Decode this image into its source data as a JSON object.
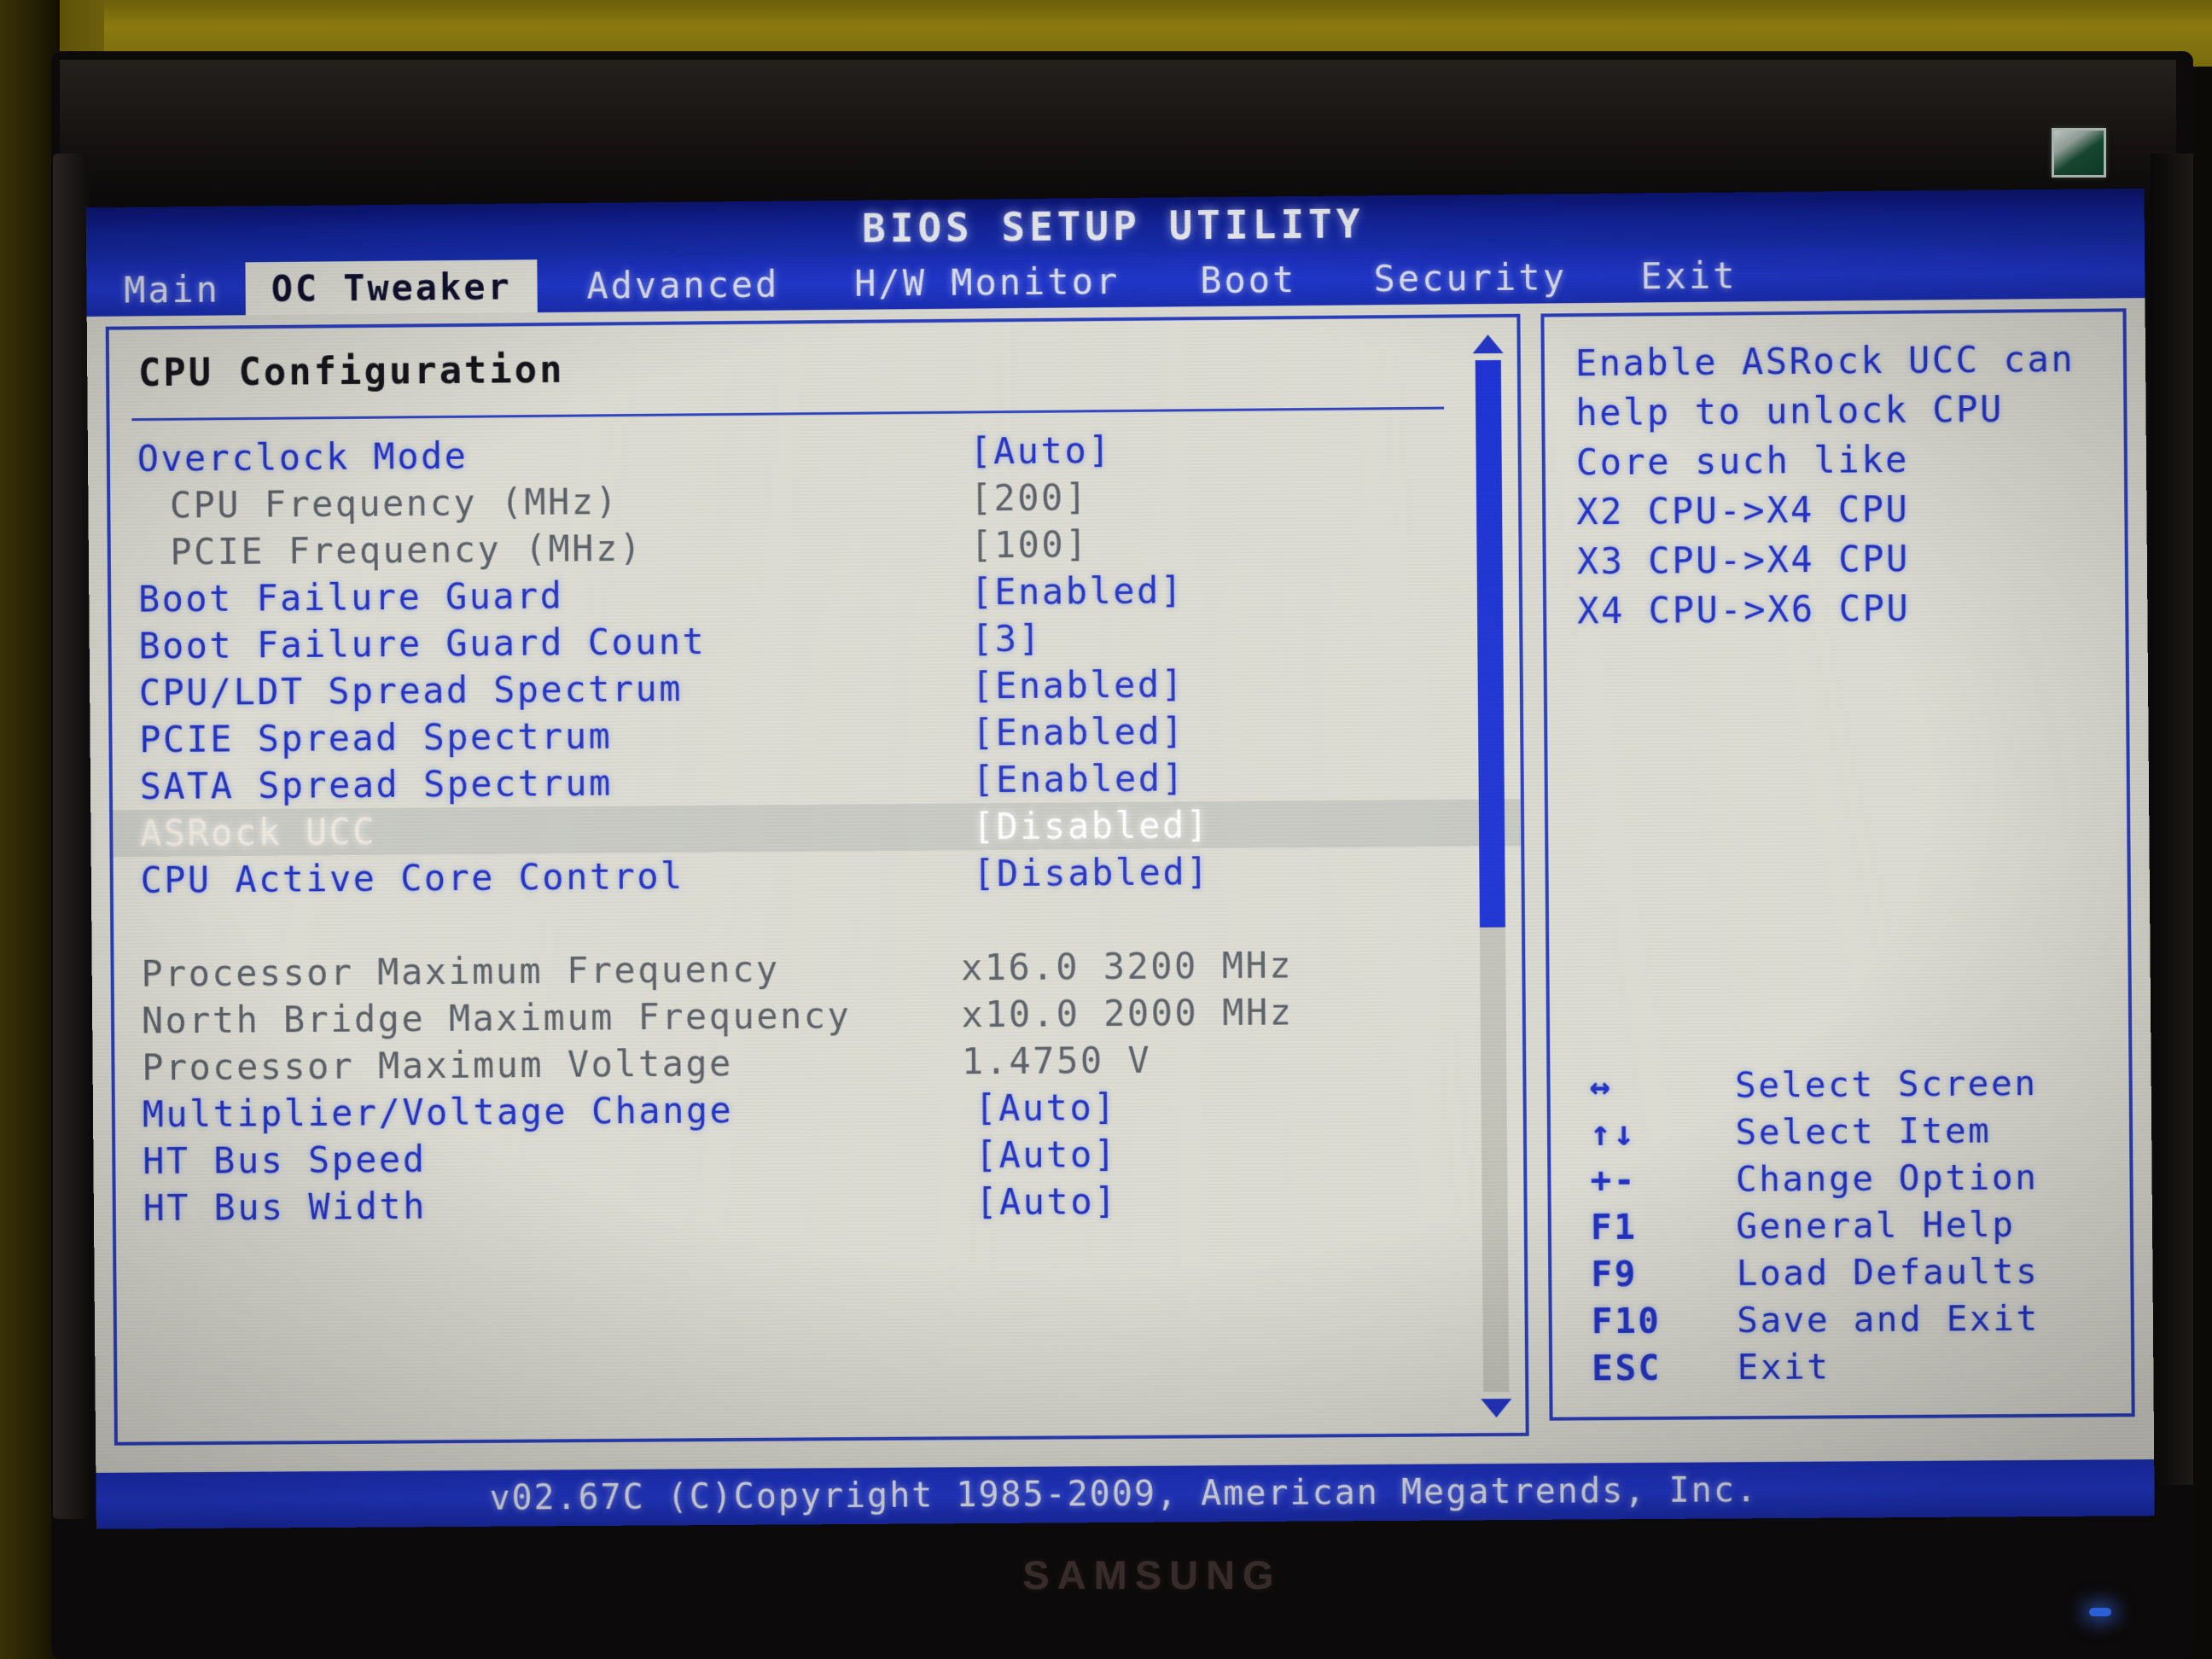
{
  "window": {
    "title": "BIOS SETUP UTILITY",
    "monitor_brand": "SAMSUNG"
  },
  "menu": {
    "items": [
      {
        "label": "Main",
        "selected": false
      },
      {
        "label": "OC Tweaker",
        "selected": true
      },
      {
        "label": "Advanced",
        "selected": false
      },
      {
        "label": "H/W Monitor",
        "selected": false
      },
      {
        "label": "Boot",
        "selected": false
      },
      {
        "label": "Security",
        "selected": false
      },
      {
        "label": "Exit",
        "selected": false
      }
    ]
  },
  "main_panel": {
    "section_title": "CPU Configuration",
    "rows": [
      {
        "label": "Overclock Mode",
        "value": "[Auto]",
        "style": "normal",
        "indent": false
      },
      {
        "label": "CPU Frequency (MHz)",
        "value": "[200]",
        "style": "dim",
        "indent": true
      },
      {
        "label": "PCIE Frequency (MHz)",
        "value": "[100]",
        "style": "dim",
        "indent": true
      },
      {
        "label": "Boot Failure Guard",
        "value": "[Enabled]",
        "style": "normal",
        "indent": false
      },
      {
        "label": "Boot Failure Guard Count",
        "value": "[3]",
        "style": "normal",
        "indent": false
      },
      {
        "label": "CPU/LDT Spread Spectrum",
        "value": "[Enabled]",
        "style": "normal",
        "indent": false
      },
      {
        "label": "PCIE Spread Spectrum",
        "value": "[Enabled]",
        "style": "normal",
        "indent": false
      },
      {
        "label": "SATA Spread Spectrum",
        "value": "[Enabled]",
        "style": "normal",
        "indent": false
      },
      {
        "label": "ASRock UCC",
        "value": "[Disabled]",
        "style": "selected",
        "indent": false
      },
      {
        "label": "CPU Active Core Control",
        "value": "[Disabled]",
        "style": "normal",
        "indent": false
      },
      {
        "label": "",
        "value": "",
        "style": "blank",
        "indent": false
      },
      {
        "label": "Processor Maximum Frequency",
        "value": "x16.0 3200 MHz",
        "style": "info",
        "indent": false
      },
      {
        "label": "North Bridge Maximum Frequency",
        "value": "x10.0 2000 MHz",
        "style": "info",
        "indent": false
      },
      {
        "label": "Processor Maximum Voltage",
        "value": "1.4750 V",
        "style": "info",
        "indent": false
      },
      {
        "label": "Multiplier/Voltage Change",
        "value": "[Auto]",
        "style": "normal",
        "indent": false
      },
      {
        "label": "HT Bus Speed",
        "value": "[Auto]",
        "style": "normal",
        "indent": false
      },
      {
        "label": "HT Bus Width",
        "value": "[Auto]",
        "style": "normal",
        "indent": false
      }
    ],
    "scrollbar": {
      "up_arrow": "scroll-up-arrow",
      "down_arrow": "scroll-down-arrow",
      "thumb_percent": 55
    }
  },
  "help_panel": {
    "lines": [
      "Enable ASRock UCC can",
      "help to unlock CPU",
      "Core such like",
      "X2 CPU->X4 CPU",
      "X3 CPU->X4 CPU",
      "X4 CPU->X6 CPU"
    ],
    "legend": [
      {
        "key": "↔",
        "desc": "Select Screen"
      },
      {
        "key": "↑↓",
        "desc": "Select Item"
      },
      {
        "key": "+-",
        "desc": "Change Option"
      },
      {
        "key": "F1",
        "desc": "General Help"
      },
      {
        "key": "F9",
        "desc": "Load Defaults"
      },
      {
        "key": "F10",
        "desc": "Save and Exit"
      },
      {
        "key": "ESC",
        "desc": "Exit"
      }
    ]
  },
  "footer": {
    "text": "v02.67C (C)Copyright 1985-2009, American Megatrends, Inc."
  },
  "colors": {
    "title_bar_blue": "#13249e",
    "menu_blue": "#2138cf",
    "screen_bg": "#d9d9d0",
    "text_blue": "#2233c4",
    "dim_gray": "#5c6069",
    "selected_white": "#ffffff",
    "selected_row_bg": "#c8c9c3",
    "border_blue": "#2b3fbf"
  }
}
